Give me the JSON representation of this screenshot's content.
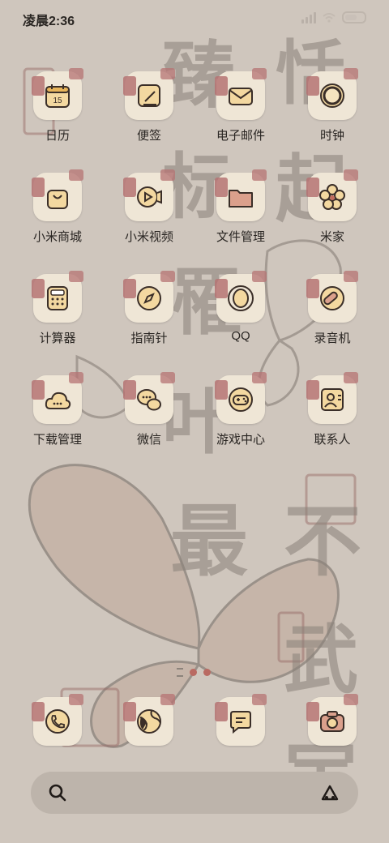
{
  "status_bar": {
    "time": "凌晨2:36"
  },
  "background": {
    "calligraphy": [
      "臻",
      "恬",
      "标",
      "起",
      "罹",
      "叶",
      "最",
      "不",
      "武",
      "宝"
    ]
  },
  "apps": [
    {
      "label": "日历",
      "icon": "calendar-icon",
      "day_text": "15"
    },
    {
      "label": "便签",
      "icon": "notes-icon"
    },
    {
      "label": "电子邮件",
      "icon": "mail-icon"
    },
    {
      "label": "时钟",
      "icon": "clock-icon"
    },
    {
      "label": "小米商城",
      "icon": "shopping-bag-icon"
    },
    {
      "label": "小米视频",
      "icon": "video-camera-icon"
    },
    {
      "label": "文件管理",
      "icon": "folder-icon"
    },
    {
      "label": "米家",
      "icon": "flower-icon"
    },
    {
      "label": "计算器",
      "icon": "calculator-icon"
    },
    {
      "label": "指南针",
      "icon": "compass-icon"
    },
    {
      "label": "QQ",
      "icon": "qq-penguin-icon"
    },
    {
      "label": "录音机",
      "icon": "recorder-icon"
    },
    {
      "label": "下载管理",
      "icon": "cloud-download-icon"
    },
    {
      "label": "微信",
      "icon": "wechat-icon"
    },
    {
      "label": "游戏中心",
      "icon": "gamepad-icon"
    },
    {
      "label": "联系人",
      "icon": "contacts-icon"
    }
  ],
  "dock": [
    {
      "icon": "phone-icon"
    },
    {
      "icon": "browser-globe-icon"
    },
    {
      "icon": "messages-icon"
    },
    {
      "icon": "camera-icon"
    }
  ],
  "colors": {
    "background": "#cfc6bd",
    "icon_bg": "#efe6d6",
    "accent_seal": "#b57373",
    "glyph_fill": "#f3d8a0",
    "stroke": "#3a2e28"
  }
}
